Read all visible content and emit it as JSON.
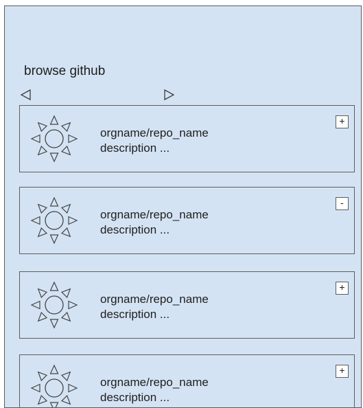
{
  "header": {
    "title": "browse github",
    "prev_icon": "triangle-left-icon",
    "next_icon": "triangle-right-icon"
  },
  "repos": [
    {
      "name": "orgname/repo_name",
      "description": "description ...",
      "toggle": "+",
      "icon": "sun-icon"
    },
    {
      "name": "orgname/repo_name",
      "description": "description ...",
      "toggle": "-",
      "icon": "sun-icon"
    },
    {
      "name": "orgname/repo_name",
      "description": "description ...",
      "toggle": "+",
      "icon": "sun-icon"
    },
    {
      "name": "orgname/repo_name",
      "description": "description ...",
      "toggle": "+",
      "icon": "sun-icon"
    }
  ],
  "colors": {
    "background": "#d4e3f3",
    "stroke": "#5c5c5c"
  }
}
